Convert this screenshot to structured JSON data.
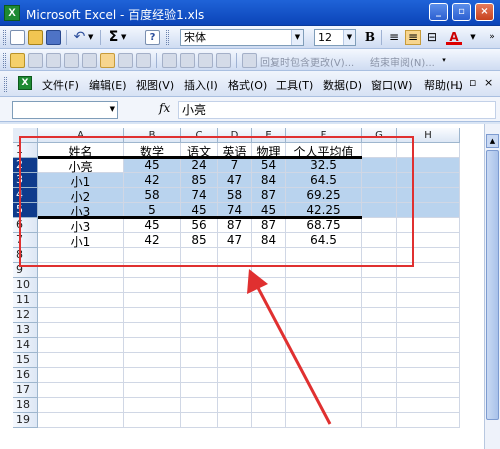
{
  "window": {
    "title": "Microsoft Excel - 百度经验1.xls",
    "app_icon": "X"
  },
  "toolbar": {
    "font_name": "宋体",
    "font_size": "12",
    "bold_label": "B",
    "font_color_label": "A",
    "review_reply": "回复时包含更改(V)...",
    "review_end": "结束审阅(N)..."
  },
  "menu": {
    "items": [
      "文件(F)",
      "编辑(E)",
      "视图(V)",
      "插入(I)",
      "格式(O)",
      "工具(T)",
      "数据(D)",
      "窗口(W)",
      "帮助(H)"
    ],
    "window_controls": "_ ▫ ×"
  },
  "formula_bar": {
    "name_box": "",
    "fx_label": "fx",
    "content": "小亮"
  },
  "grid": {
    "columns": [
      "A",
      "B",
      "C",
      "D",
      "E",
      "F",
      "G",
      "H"
    ],
    "row_numbers": [
      "1",
      "2",
      "3",
      "4",
      "5",
      "6",
      "7",
      "8",
      "9",
      "10",
      "11",
      "12",
      "13",
      "14",
      "15",
      "16",
      "17",
      "18",
      "19"
    ],
    "header_row": [
      "姓名",
      "数学",
      "语文",
      "英语",
      "物理",
      "个人平均值"
    ],
    "rows": [
      [
        "小亮",
        "45",
        "24",
        "7",
        "54",
        "32.5"
      ],
      [
        "小1",
        "42",
        "85",
        "47",
        "84",
        "64.5"
      ],
      [
        "小2",
        "58",
        "74",
        "58",
        "87",
        "69.25"
      ],
      [
        "小3",
        "5",
        "45",
        "74",
        "45",
        "42.25"
      ],
      [
        "小3",
        "45",
        "56",
        "87",
        "87",
        "68.75"
      ],
      [
        "小1",
        "42",
        "85",
        "47",
        "84",
        "64.5"
      ]
    ],
    "selected_rows": [
      "2",
      "3",
      "4",
      "5"
    ]
  },
  "colors": {
    "selection": "#b9d3ee",
    "annotation_red": "#e03030",
    "title_blue": "#0b44b8"
  }
}
